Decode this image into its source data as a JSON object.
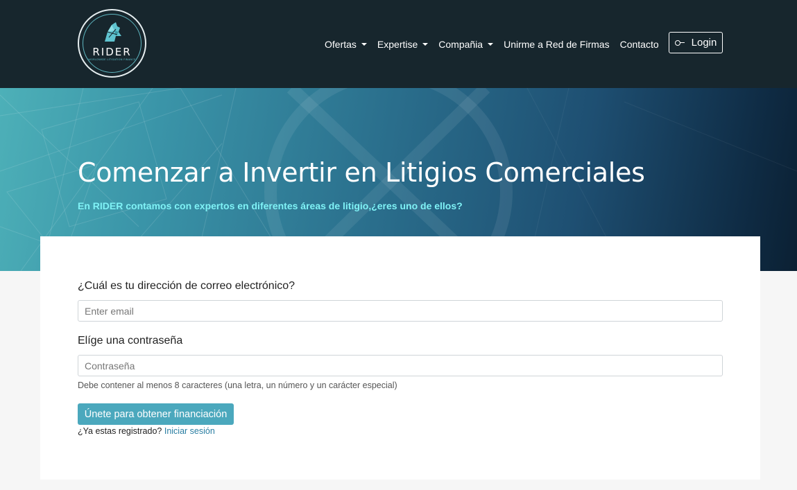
{
  "brand": {
    "logo_word": "RIDER",
    "logo_tagline": "WORLDWIDE LITIGATION FINANCE"
  },
  "nav": {
    "items": [
      {
        "label": "Ofertas",
        "dropdown": true
      },
      {
        "label": "Expertise",
        "dropdown": true
      },
      {
        "label": "Compañia",
        "dropdown": true
      },
      {
        "label": "Unirme a Red de Firmas",
        "dropdown": false
      },
      {
        "label": "Contacto",
        "dropdown": false
      }
    ],
    "login_label": "Login",
    "login_icon": "key-icon"
  },
  "hero": {
    "title": "Comenzar a Invertir en Litigios Comerciales",
    "subtitle": "En RIDER contamos con expertos en diferentes áreas de litigio,¿eres uno de ellos?"
  },
  "form": {
    "email_label": "¿Cuál es tu dirección de correo electrónico?",
    "email_placeholder": "Enter email",
    "email_value": "",
    "password_label": "Elíge una contraseña",
    "password_placeholder": "Contraseña",
    "password_value": "",
    "password_help": "Debe contener al menos 8 caracteres (una letra, un número y un carácter especial)",
    "submit_label": "Únete para obtener financiación",
    "already_text": "¿Ya estas registrado?",
    "signin_link": "Iniciar sesión"
  },
  "colors": {
    "navbar_bg": "#17262d",
    "hero_subtitle": "#7ff2f6",
    "button_bg": "#4ba8bd",
    "link": "#2a7ea2",
    "page_bg": "#f6f6f6"
  }
}
